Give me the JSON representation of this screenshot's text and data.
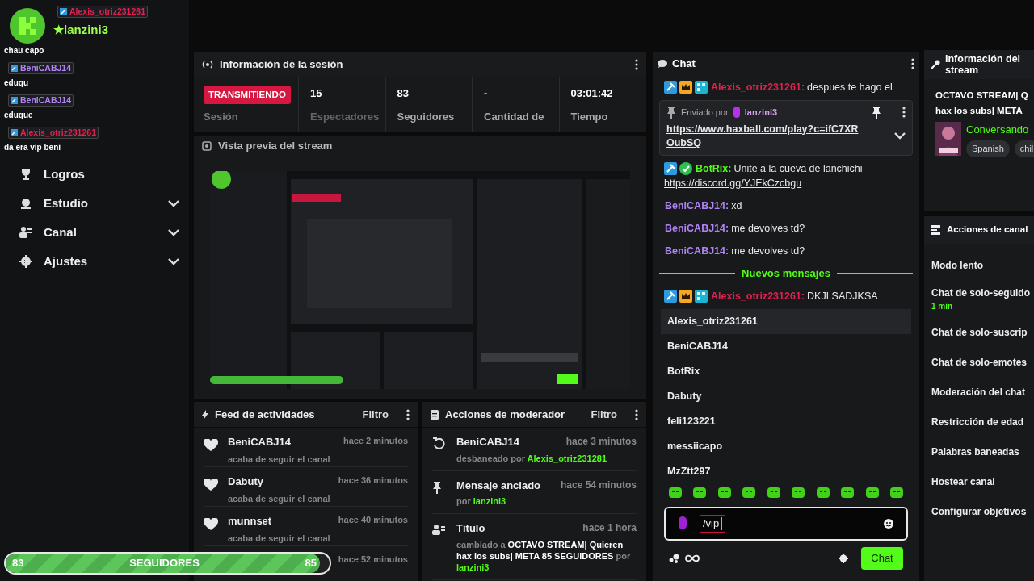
{
  "overlay": {
    "streamer": "★lanzini3",
    "messages": [
      {
        "user": "Alexis_otriz231261",
        "color": "#e0224e"
      },
      {
        "text": "chau capo"
      },
      {
        "user": "BeniCABJ14",
        "color": "#b084f5",
        "text": "eduqu"
      },
      {
        "user": "BeniCABJ14",
        "color": "#b084f5",
        "text": "eduque"
      },
      {
        "user": "Alexis_otriz231261",
        "color": "#e0224e",
        "text": "da era vip beni"
      }
    ]
  },
  "sidebar": {
    "items": [
      {
        "label": "Logros",
        "kind": "trophy",
        "expandable": false
      },
      {
        "label": "Estudio",
        "kind": "studio",
        "expandable": true
      },
      {
        "label": "Canal",
        "kind": "people",
        "expandable": true
      },
      {
        "label": "Ajustes",
        "kind": "gear",
        "expandable": true
      }
    ]
  },
  "session": {
    "title": "Información de la sesión",
    "status": "TRANSMITIENDO",
    "status_label": "Sesión",
    "stats": [
      {
        "value": "15",
        "label": "Espectadores"
      },
      {
        "value": "83",
        "label": "Seguidores"
      },
      {
        "value": "-",
        "label": "Cantidad de"
      },
      {
        "value": "03:01:42",
        "label": "Tiempo"
      }
    ]
  },
  "preview": {
    "title": "Vista previa del stream",
    "kind": "picture"
  },
  "feed": {
    "title": "Feed de actividades",
    "filter": "Filtro",
    "items": [
      {
        "user": "BeniCABJ14",
        "time": "hace 2 minutos",
        "text": "acaba de seguir el canal"
      },
      {
        "user": "Dabuty",
        "time": "hace 36 minutos",
        "text": "acaba de seguir el canal"
      },
      {
        "user": "munnset",
        "time": "hace 40 minutos",
        "text": "acaba de seguir el canal"
      },
      {
        "time": "hace 52 minutos"
      }
    ]
  },
  "mod_actions": {
    "title": "Acciones de moderador",
    "filter": "Filtro",
    "items": [
      {
        "kind": "unban",
        "title": "BeniCABJ14",
        "time": "hace 3 minutos",
        "text": "desbaneado por",
        "by": "Alexis_otriz231281"
      },
      {
        "kind": "pin",
        "title": "Mensaje anclado",
        "time": "hace 54 minutos",
        "text": "por",
        "by": "lanzini3"
      },
      {
        "kind": "title",
        "title": "Título",
        "time": "hace 1 hora",
        "text": "cambiado a **OCTAVO STREAM| Quieren hax los subs| META 85 SEGUIDORES** por",
        "by": "lanzini3"
      }
    ]
  },
  "goal": {
    "start": "83",
    "label": "SEGUIDORES",
    "end": "85",
    "level": 0.97
  },
  "chat": {
    "title": "Chat",
    "pinned": {
      "label": "Enviado por",
      "user": "lanzini3",
      "link": "https://www.haxball.com/play?c=ifC7XROubSQ"
    },
    "messages": [
      {
        "kind": "message",
        "user": "Alexis_otriz231261:",
        "color": "#e0224e",
        "badges": [
          {
            "kind": "mod"
          },
          {
            "kind": "vip"
          },
          {
            "kind": "og"
          }
        ],
        "text": "despues te hago el"
      },
      {
        "kind": "message",
        "user": "BotRix:",
        "color": "#53fc18",
        "badges": [
          {
            "kind": "mod"
          },
          {
            "kind": "verified"
          }
        ],
        "text": "Unite a la cueva de lanchichi",
        "link": "https://discord.gg/YJEkCzcbgu"
      },
      {
        "kind": "message",
        "user": "BeniCABJ14:",
        "color": "#b084f5",
        "text": "xd"
      },
      {
        "kind": "message",
        "user": "BeniCABJ14:",
        "color": "#b084f5",
        "text": "me devolves td?"
      },
      {
        "kind": "message",
        "user": "BeniCABJ14:",
        "color": "#b084f5",
        "text": "me devolves td?"
      },
      {
        "kind": "divider",
        "text": "Nuevos mensajes"
      },
      {
        "kind": "message",
        "user": "Alexis_otriz231261:",
        "color": "#e0224e",
        "badges": [
          {
            "kind": "mod"
          },
          {
            "kind": "vip"
          },
          {
            "kind": "og"
          }
        ],
        "text": "DKJLSADJKSA"
      }
    ],
    "mentions": [
      {
        "name": "Alexis_otriz231261",
        "selected": true
      },
      {
        "name": "BeniCABJ14",
        "selected": false
      },
      {
        "name": "BotRix",
        "selected": false
      },
      {
        "name": "Dabuty",
        "selected": false
      },
      {
        "name": "feli123221",
        "selected": false
      },
      {
        "name": "messiicapo",
        "selected": false
      },
      {
        "name": "MzZtt297",
        "selected": false
      }
    ],
    "input": {
      "value": "/vip"
    },
    "send": "Chat"
  },
  "stream_info": {
    "title": "Información del stream",
    "title_lines": [
      "OCTAVO STREAM| Q",
      "hax los subs| META"
    ],
    "category": "Conversando",
    "tags": [
      "Spanish",
      "chil"
    ]
  },
  "channel_actions": {
    "title": "Acciones de canal",
    "items": [
      {
        "label": "Modo lento"
      },
      {
        "label": "Chat de solo-seguido",
        "detail": "1 min"
      },
      {
        "label": "Chat de solo-suscrip"
      },
      {
        "label": "Chat de solo-emotes"
      },
      {
        "label": "Moderación del chat"
      },
      {
        "label": "Restricción de edad"
      },
      {
        "label": "Palabras baneadas"
      },
      {
        "label": "Hostear canal"
      },
      {
        "label": "Configurar objetivos"
      }
    ]
  }
}
